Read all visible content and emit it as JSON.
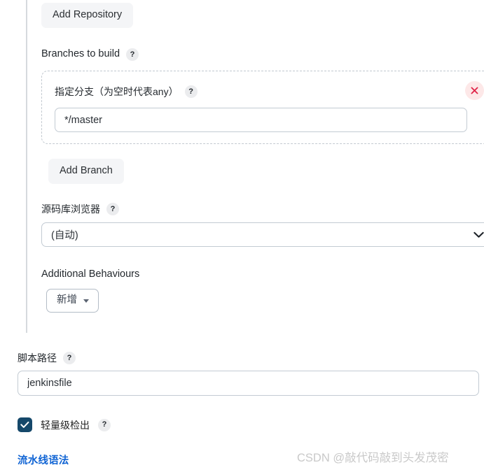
{
  "scm": {
    "add_repository_label": "Add Repository",
    "branches_section": {
      "label": "Branches to build",
      "help": "?",
      "entry": {
        "label": "指定分支（为空时代表any）",
        "help": "?",
        "value": "*/master",
        "remove_icon": "close-icon"
      },
      "add_branch_label": "Add Branch"
    },
    "repository_browser": {
      "label": "源码库浏览器",
      "help": "?",
      "selected": "(自动)",
      "chevron_icon": "chevron-down-icon"
    },
    "additional_behaviours": {
      "label": "Additional Behaviours",
      "add_label": "新增",
      "caret_icon": "caret-down-icon"
    }
  },
  "pipeline": {
    "script_path": {
      "label": "脚本路径",
      "help": "?",
      "value": "jenkinsfile"
    },
    "lightweight_checkout": {
      "label": "轻量级检出",
      "help": "?",
      "checked": true,
      "check_icon": "checkmark-icon"
    },
    "syntax_link": "流水线语法"
  },
  "watermark": {
    "text": "CSDN @敲代码敲到头发茂密"
  },
  "colors": {
    "accent_checkbox": "#15486a",
    "link": "#1064d4",
    "remove_badge_bg": "#fde8e8",
    "remove_x": "#e0264a"
  }
}
